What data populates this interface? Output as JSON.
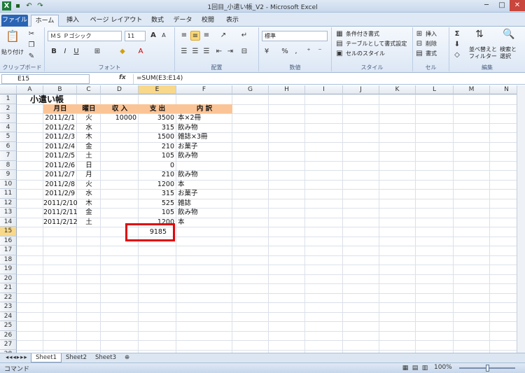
{
  "window": {
    "title": "1回目_小遣い帳_V2 - Microsoft Excel",
    "minimize": "─",
    "maximize": "□",
    "close": "✕"
  },
  "qat": {
    "save_icon": "save-icon",
    "undo_icon": "undo-icon",
    "redo_icon": "redo-icon"
  },
  "tabs": [
    "ファイル",
    "ホーム",
    "挿入",
    "ページ レイアウト",
    "数式",
    "データ",
    "校閲",
    "表示"
  ],
  "ribbon": {
    "clipboard": {
      "label": "クリップボード",
      "paste": "貼り付け"
    },
    "font": {
      "label": "フォント",
      "name": "ＭＳ Ｐゴシック",
      "size": "11",
      "bold": "B",
      "italic": "I",
      "underline": "U",
      "grow": "A",
      "shrink": "A"
    },
    "alignment": {
      "label": "配置"
    },
    "number": {
      "label": "数値",
      "format": "標準",
      "percent": "%",
      "comma": ","
    },
    "styles": {
      "label": "スタイル",
      "conditional": "条件付き書式",
      "table": "テーブルとして書式設定",
      "cell": "セルのスタイル"
    },
    "cells": {
      "label": "セル",
      "insert": "挿入",
      "delete": "削除",
      "format": "書式"
    },
    "editing": {
      "label": "編集",
      "sum": "Σ",
      "sort": "並べ替えと",
      "sort2": "フィルター",
      "find": "検索と",
      "find2": "選択"
    }
  },
  "formula_bar": {
    "name_box": "E15",
    "fx": "fx",
    "formula": "=SUM(E3:E14)"
  },
  "columns": [
    "A",
    "B",
    "C",
    "D",
    "E",
    "F",
    "G",
    "H",
    "I",
    "J",
    "K",
    "L",
    "M",
    "N"
  ],
  "rows": [
    "1",
    "2",
    "3",
    "4",
    "5",
    "6",
    "7",
    "8",
    "9",
    "10",
    "11",
    "12",
    "13",
    "14",
    "15",
    "16",
    "17",
    "18",
    "19",
    "20",
    "21",
    "22",
    "23",
    "24",
    "25",
    "26",
    "27",
    "28"
  ],
  "sheet": {
    "title": "小遣い帳",
    "headers": [
      "月日",
      "曜日",
      "収 入",
      "支 出",
      "内 訳"
    ],
    "records": [
      {
        "date": "2011/2/1",
        "day": "火",
        "income": "10000",
        "expense": "3500",
        "note": "本×2冊"
      },
      {
        "date": "2011/2/2",
        "day": "水",
        "income": "",
        "expense": "315",
        "note": "飲み物"
      },
      {
        "date": "2011/2/3",
        "day": "木",
        "income": "",
        "expense": "1500",
        "note": "雑誌×3冊"
      },
      {
        "date": "2011/2/4",
        "day": "金",
        "income": "",
        "expense": "210",
        "note": "お菓子"
      },
      {
        "date": "2011/2/5",
        "day": "土",
        "income": "",
        "expense": "105",
        "note": "飲み物"
      },
      {
        "date": "2011/2/6",
        "day": "日",
        "income": "",
        "expense": "0",
        "note": ""
      },
      {
        "date": "2011/2/7",
        "day": "月",
        "income": "",
        "expense": "210",
        "note": "飲み物"
      },
      {
        "date": "2011/2/8",
        "day": "火",
        "income": "",
        "expense": "1200",
        "note": "本"
      },
      {
        "date": "2011/2/9",
        "day": "水",
        "income": "",
        "expense": "315",
        "note": "お菓子"
      },
      {
        "date": "2011/2/10",
        "day": "木",
        "income": "",
        "expense": "525",
        "note": "雑誌"
      },
      {
        "date": "2011/2/11",
        "day": "金",
        "income": "",
        "expense": "105",
        "note": "飲み物"
      },
      {
        "date": "2011/2/12",
        "day": "土",
        "income": "",
        "expense": "1200",
        "note": "本"
      }
    ],
    "total": "9185"
  },
  "sheet_tabs": [
    "Sheet1",
    "Sheet2",
    "Sheet3"
  ],
  "status": {
    "mode": "コマンド",
    "zoom": "100%"
  },
  "colors": {
    "header_fill": "#fbc496",
    "highlight": "#e0060c",
    "selection": "#f8d88a"
  }
}
